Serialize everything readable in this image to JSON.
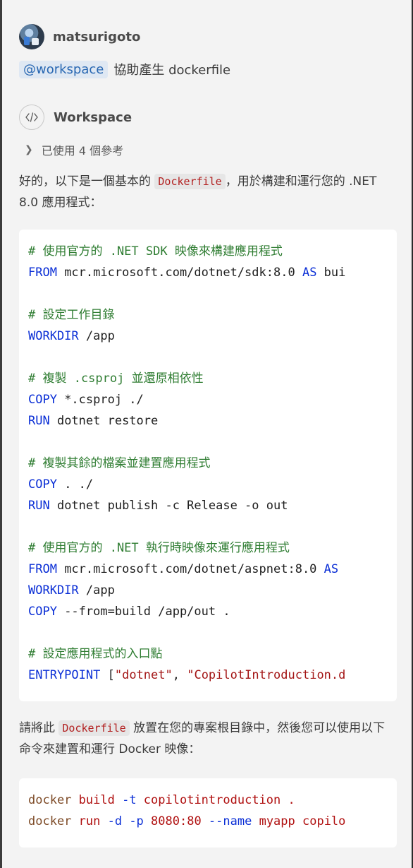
{
  "user": {
    "name": "matsurigoto",
    "avatar_icon": "user-avatar"
  },
  "prompt": {
    "mention": "@workspace",
    "text": "協助產生 dockerfile"
  },
  "agent": {
    "name": "Workspace",
    "icon": "code-icon"
  },
  "references": {
    "label": "已使用 4 個參考",
    "icon": "chevron-right-icon"
  },
  "para1": {
    "before": "好的，以下是一個基本的 ",
    "code": "Dockerfile",
    "after": "，用於構建和運行您的 .NET 8.0 應用程式："
  },
  "dockerfile": {
    "l1": "# 使用官方的 .NET SDK 映像來構建應用程式",
    "l2_kw": "FROM",
    "l2_rest": " mcr.microsoft.com/dotnet/sdk:8.0 ",
    "l2_kw2": "AS",
    "l2_tail": " bui",
    "l3": "# 設定工作目錄",
    "l4_kw": "WORKDIR",
    "l4_rest": " /app",
    "l5": "# 複製 .csproj 並還原相依性",
    "l6_kw": "COPY",
    "l6_rest": " *.csproj ./",
    "l7_kw": "RUN",
    "l7_rest": " dotnet restore",
    "l8": "# 複製其餘的檔案並建置應用程式",
    "l9_kw": "COPY",
    "l9_rest": " . ./",
    "l10_kw": "RUN",
    "l10_rest": " dotnet publish -c Release -o out",
    "l11": "# 使用官方的 .NET 執行時映像來運行應用程式",
    "l12_kw": "FROM",
    "l12_rest": " mcr.microsoft.com/dotnet/aspnet:8.0 ",
    "l12_kw2": "AS",
    "l13_kw": "WORKDIR",
    "l13_rest": " /app",
    "l14_kw": "COPY",
    "l14_rest": " --from=build /app/out .",
    "l15": "# 設定應用程式的入口點",
    "l16_kw": "ENTRYPOINT",
    "l16_p1": " [",
    "l16_s1": "\"dotnet\"",
    "l16_p2": ", ",
    "l16_s2": "\"CopilotIntroduction.d"
  },
  "para2": {
    "before": "請將此 ",
    "code": "Dockerfile",
    "after": " 放置在您的專案根目錄中，然後您可以使用以下命令來建置和運行 Docker 映像："
  },
  "commands": {
    "c1_a": "docker",
    "c1_b": " build ",
    "c1_c": "-t",
    "c1_d": " copilotintroduction .",
    "c2_a": "docker",
    "c2_b": " run ",
    "c2_c": "-d -p",
    "c2_d": " 8080:80 ",
    "c2_e": "--name",
    "c2_f": " myapp copilo"
  },
  "colors": {
    "keyword": "#0b2fd6",
    "comment": "#2f7d32",
    "string": "#a31515",
    "mention": "#2867b2"
  }
}
